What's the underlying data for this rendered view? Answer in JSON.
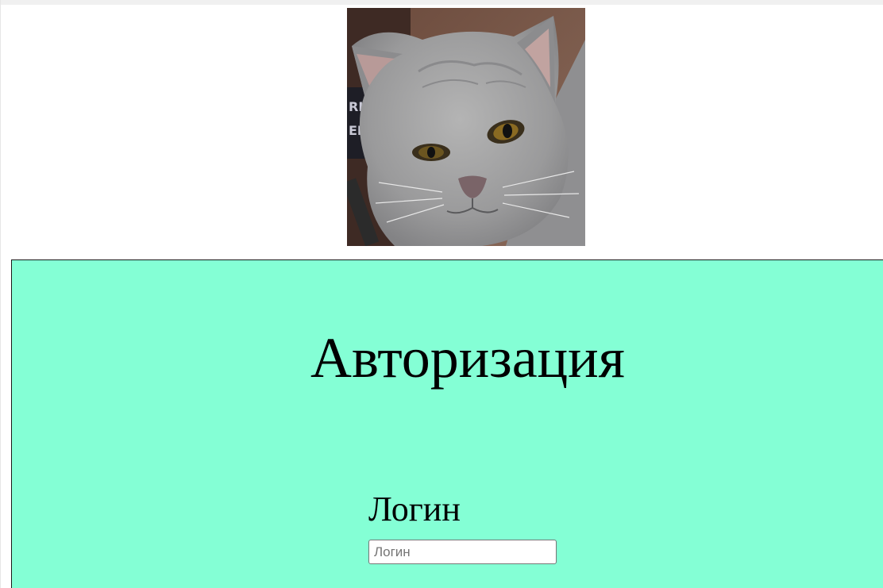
{
  "auth": {
    "title": "Авторизация",
    "login_label": "Логин",
    "login_placeholder": "Логин",
    "login_value": ""
  },
  "colors": {
    "panel_background": "#84ffd5",
    "panel_border": "#1a1a1a",
    "page_background": "#ffffff"
  },
  "icons": {
    "cat_photo": "gray-british-shorthair-cat-photo"
  }
}
